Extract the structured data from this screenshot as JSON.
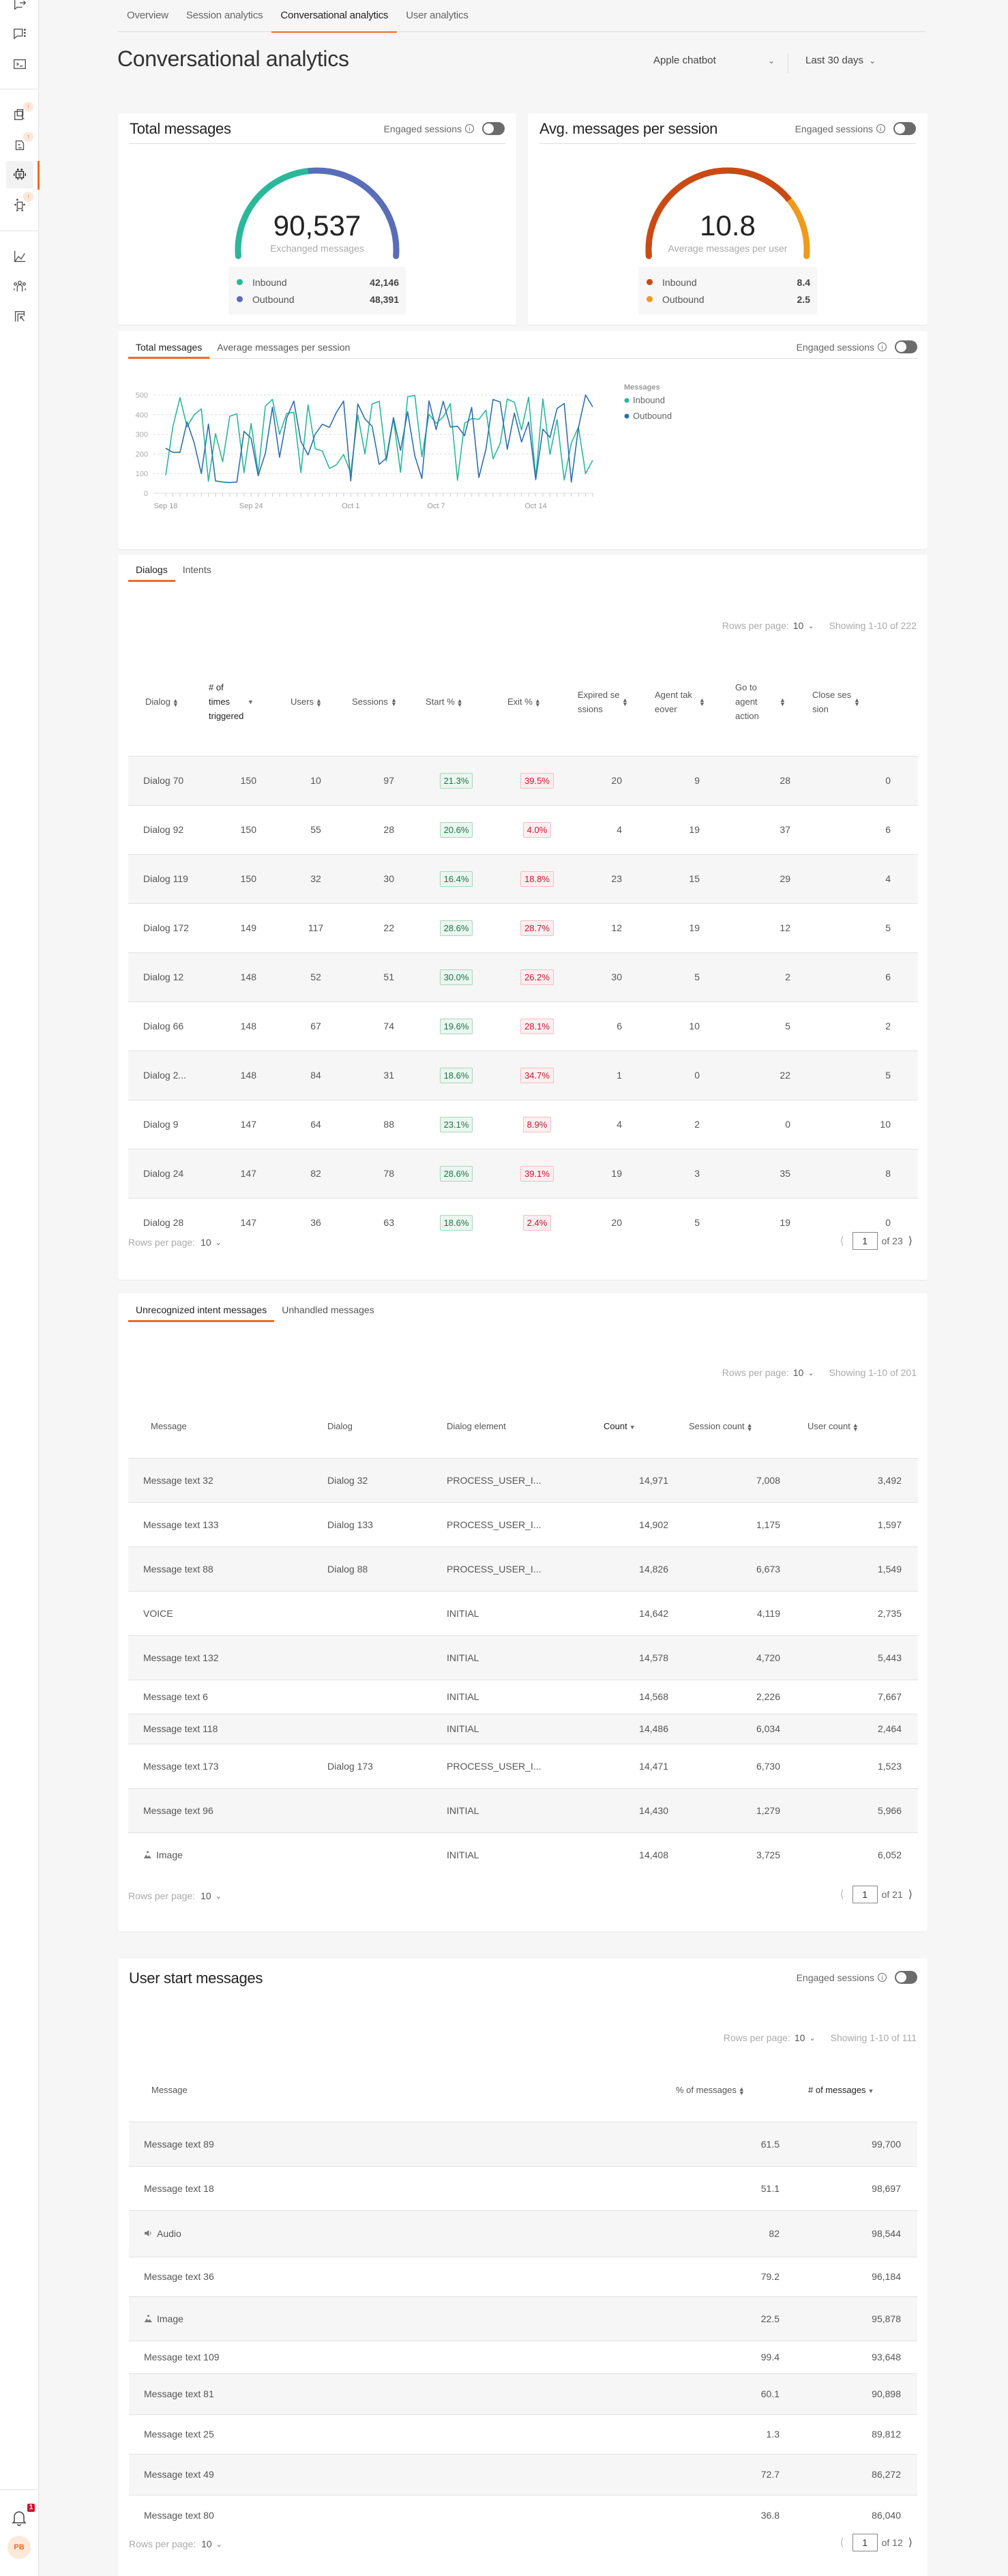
{
  "sidebar": {
    "notification_count": "1",
    "avatar_initials": "PB",
    "update_badge": "↑"
  },
  "top_tabs": [
    {
      "label": "Overview",
      "active": false
    },
    {
      "label": "Session analytics",
      "active": false
    },
    {
      "label": "Conversational analytics",
      "active": true
    },
    {
      "label": "User analytics",
      "active": false
    }
  ],
  "page_title": "Conversational analytics",
  "filters": {
    "chatbot": "Apple chatbot",
    "date_range": "Last 30 days"
  },
  "engaged_sessions_label": "Engaged sessions",
  "total_messages_card": {
    "title": "Total messages",
    "value": "90,537",
    "caption": "Exchanged messages",
    "legend": [
      {
        "label": "Inbound",
        "value": "42,146",
        "color": "#2bb89a"
      },
      {
        "label": "Outbound",
        "value": "48,391",
        "color": "#5a6db8"
      }
    ],
    "inbound_share": 0.4655
  },
  "avg_messages_card": {
    "title": "Avg. messages per session",
    "value": "10.8",
    "caption": "Average messages per user",
    "legend": [
      {
        "label": "Inbound",
        "value": "8.4",
        "color": "#c94a14"
      },
      {
        "label": "Outbound",
        "value": "2.5",
        "color": "#ee9a1c"
      }
    ],
    "inbound_share": 0.77
  },
  "chart_tabs": [
    {
      "label": "Total messages",
      "active": true
    },
    {
      "label": "Average messages per session",
      "active": false
    }
  ],
  "chart_data": {
    "type": "line",
    "title": "Total messages",
    "xlabel": "",
    "ylabel": "",
    "ylim": [
      0,
      500
    ],
    "yticks": [
      0,
      100,
      200,
      300,
      400,
      500
    ],
    "grid": true,
    "legend_title": "Messages",
    "legend_position": "right",
    "x_tick_labels": [
      {
        "index": 0,
        "label": "Sep 18"
      },
      {
        "index": 12,
        "label": "Sep 24"
      },
      {
        "index": 26,
        "label": "Oct 1"
      },
      {
        "index": 38,
        "label": "Oct 7"
      },
      {
        "index": 52,
        "label": "Oct 14"
      }
    ],
    "point_count": 61,
    "series": [
      {
        "name": "Inbound",
        "color": "#2bb89a",
        "values": [
          92,
          338,
          486,
          338,
          400,
          429,
          61,
          303,
          160,
          392,
          404,
          105,
          355,
          103,
          443,
          478,
          300,
          406,
          412,
          105,
          450,
          227,
          215,
          126,
          145,
          197,
          103,
          398,
          200,
          454,
          468,
          164,
          379,
          107,
          491,
          498,
          186,
          402,
          356,
          388,
          456,
          66,
          356,
          380,
          376,
          423,
          175,
          253,
          479,
          463,
          322,
          489,
          80,
          480,
          198,
          375,
          67,
          255,
          337,
          100,
          167
        ]
      },
      {
        "name": "Outbound",
        "color": "#2f6fad",
        "values": [
          229,
          208,
          208,
          363,
          257,
          100,
          352,
          63,
          57,
          54,
          57,
          315,
          279,
          89,
          203,
          438,
          183,
          383,
          469,
          263,
          195,
          300,
          351,
          335,
          412,
          469,
          63,
          454,
          378,
          341,
          147,
          178,
          385,
          218,
          415,
          191,
          75,
          471,
          324,
          468,
          337,
          341,
          293,
          437,
          80,
          224,
          477,
          465,
          224,
          408,
          261,
          362,
          69,
          326,
          284,
          431,
          457,
          57,
          333,
          500,
          440
        ]
      }
    ]
  },
  "dialogs_card": {
    "tabs": [
      {
        "label": "Dialogs",
        "active": true
      },
      {
        "label": "Intents",
        "active": false
      }
    ],
    "rows_per_page_label": "Rows per page:",
    "rows_per_page": "10",
    "showing": "Showing 1-10 of 222",
    "columns": [
      "Dialog",
      "# of times triggered",
      "Users",
      "Sessions",
      "Start %",
      "Exit %",
      "Expired sessions",
      "Agent takeover",
      "Go to agent action",
      "Close session"
    ],
    "rows": [
      {
        "dialog": "Dialog 70",
        "triggered": "150",
        "users": "10",
        "sessions": "97",
        "start": "21.3%",
        "exit": "39.5%",
        "expired": "20",
        "takeover": "9",
        "goto_agent": "28",
        "close": "0"
      },
      {
        "dialog": "Dialog 92",
        "triggered": "150",
        "users": "55",
        "sessions": "28",
        "start": "20.6%",
        "exit": "4.0%",
        "expired": "4",
        "takeover": "19",
        "goto_agent": "37",
        "close": "6"
      },
      {
        "dialog": "Dialog 119",
        "triggered": "150",
        "users": "32",
        "sessions": "30",
        "start": "16.4%",
        "exit": "18.8%",
        "expired": "23",
        "takeover": "15",
        "goto_agent": "29",
        "close": "4"
      },
      {
        "dialog": "Dialog 172",
        "triggered": "149",
        "users": "117",
        "sessions": "22",
        "start": "28.6%",
        "exit": "28.7%",
        "expired": "12",
        "takeover": "19",
        "goto_agent": "12",
        "close": "5"
      },
      {
        "dialog": "Dialog 12",
        "triggered": "148",
        "users": "52",
        "sessions": "51",
        "start": "30.0%",
        "exit": "26.2%",
        "expired": "30",
        "takeover": "5",
        "goto_agent": "2",
        "close": "6"
      },
      {
        "dialog": "Dialog 66",
        "triggered": "148",
        "users": "67",
        "sessions": "74",
        "start": "19.6%",
        "exit": "28.1%",
        "expired": "6",
        "takeover": "10",
        "goto_agent": "5",
        "close": "2"
      },
      {
        "dialog": "Dialog 2...",
        "triggered": "148",
        "users": "84",
        "sessions": "31",
        "start": "18.6%",
        "exit": "34.7%",
        "expired": "1",
        "takeover": "0",
        "goto_agent": "22",
        "close": "5"
      },
      {
        "dialog": "Dialog 9",
        "triggered": "147",
        "users": "64",
        "sessions": "88",
        "start": "23.1%",
        "exit": "8.9%",
        "expired": "4",
        "takeover": "2",
        "goto_agent": "0",
        "close": "10"
      },
      {
        "dialog": "Dialog 24",
        "triggered": "147",
        "users": "82",
        "sessions": "78",
        "start": "28.6%",
        "exit": "39.1%",
        "expired": "19",
        "takeover": "3",
        "goto_agent": "35",
        "close": "8"
      },
      {
        "dialog": "Dialog 28",
        "triggered": "147",
        "users": "36",
        "sessions": "63",
        "start": "18.6%",
        "exit": "2.4%",
        "expired": "20",
        "takeover": "5",
        "goto_agent": "19",
        "close": "0"
      }
    ],
    "page": "1",
    "of_pages": "of 23"
  },
  "unrecognized_card": {
    "tabs": [
      {
        "label": "Unrecognized intent messages",
        "active": true
      },
      {
        "label": "Unhandled messages",
        "active": false
      }
    ],
    "rows_per_page_label": "Rows per page:",
    "rows_per_page": "10",
    "showing": "Showing 1-10 of 201",
    "columns": [
      "Message",
      "Dialog",
      "Dialog element",
      "Count",
      "Session count",
      "User count"
    ],
    "rows": [
      {
        "message": "Message text 32",
        "icon": "",
        "dialog": "Dialog 32",
        "element": "PROCESS_USER_I...",
        "count": "14,971",
        "sessions": "7,008",
        "users": "3,492"
      },
      {
        "message": "Message text 133",
        "icon": "",
        "dialog": "Dialog 133",
        "element": "PROCESS_USER_I...",
        "count": "14,902",
        "sessions": "1,175",
        "users": "1,597"
      },
      {
        "message": "Message text 88",
        "icon": "",
        "dialog": "Dialog 88",
        "element": "PROCESS_USER_I...",
        "count": "14,826",
        "sessions": "6,673",
        "users": "1,549"
      },
      {
        "message": "VOICE",
        "icon": "",
        "dialog": "",
        "element": "INITIAL",
        "count": "14,642",
        "sessions": "4,119",
        "users": "2,735"
      },
      {
        "message": "Message text 132",
        "icon": "",
        "dialog": "",
        "element": "INITIAL",
        "count": "14,578",
        "sessions": "4,720",
        "users": "5,443"
      },
      {
        "message": "Message text 6",
        "icon": "",
        "dialog": "",
        "element": "INITIAL",
        "count": "14,568",
        "sessions": "2,226",
        "users": "7,667"
      },
      {
        "message": "Message text 118",
        "icon": "",
        "dialog": "",
        "element": "INITIAL",
        "count": "14,486",
        "sessions": "6,034",
        "users": "2,464"
      },
      {
        "message": "Message text 173",
        "icon": "",
        "dialog": "Dialog 173",
        "element": "PROCESS_USER_I...",
        "count": "14,471",
        "sessions": "6,730",
        "users": "1,523"
      },
      {
        "message": "Message text 96",
        "icon": "",
        "dialog": "",
        "element": "INITIAL",
        "count": "14,430",
        "sessions": "1,279",
        "users": "5,966"
      },
      {
        "message": "Image",
        "icon": "image-icon",
        "dialog": "",
        "element": "INITIAL",
        "count": "14,408",
        "sessions": "3,725",
        "users": "6,052"
      }
    ],
    "page": "1",
    "of_pages": "of 21"
  },
  "user_start_card": {
    "title": "User start messages",
    "rows_per_page_label": "Rows per page:",
    "rows_per_page": "10",
    "showing": "Showing 1-10 of 111",
    "columns": [
      "Message",
      "% of messages",
      "# of messages"
    ],
    "rows": [
      {
        "message": "Message text 89",
        "icon": "",
        "pct": "61.5",
        "count": "99,700"
      },
      {
        "message": "Message text 18",
        "icon": "",
        "pct": "51.1",
        "count": "98,697"
      },
      {
        "message": "Audio",
        "icon": "audio-icon",
        "pct": "82",
        "count": "98,544"
      },
      {
        "message": "Message text 36",
        "icon": "",
        "pct": "79.2",
        "count": "96,184"
      },
      {
        "message": "Image",
        "icon": "image-icon",
        "pct": "22.5",
        "count": "95,878"
      },
      {
        "message": "Message text 109",
        "icon": "",
        "pct": "99.4",
        "count": "93,648"
      },
      {
        "message": "Message text 81",
        "icon": "",
        "pct": "60.1",
        "count": "90,898"
      },
      {
        "message": "Message text 25",
        "icon": "",
        "pct": "1.3",
        "count": "89,812"
      },
      {
        "message": "Message text 49",
        "icon": "",
        "pct": "72.7",
        "count": "86,272"
      },
      {
        "message": "Message text 80",
        "icon": "",
        "pct": "36.8",
        "count": "86,040"
      }
    ],
    "page": "1",
    "of_pages": "of 12"
  }
}
